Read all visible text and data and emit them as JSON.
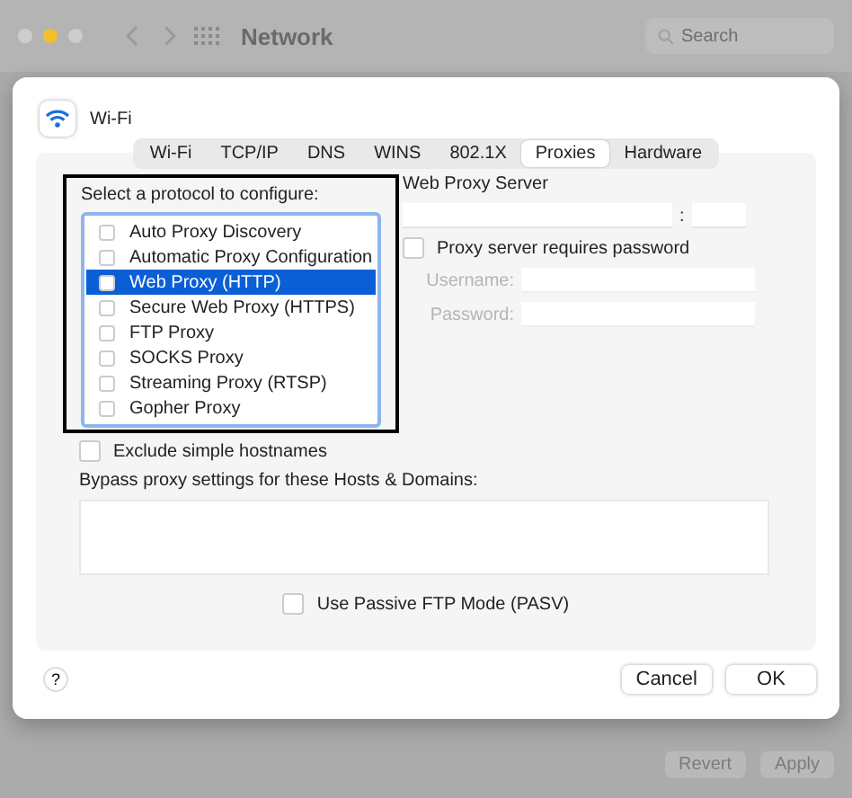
{
  "window": {
    "title": "Network",
    "search": {
      "placeholder": "Search"
    }
  },
  "sheet": {
    "service": "Wi-Fi",
    "tabs": [
      {
        "label": "Wi-Fi",
        "selected": false
      },
      {
        "label": "TCP/IP",
        "selected": false
      },
      {
        "label": "DNS",
        "selected": false
      },
      {
        "label": "WINS",
        "selected": false
      },
      {
        "label": "802.1X",
        "selected": false
      },
      {
        "label": "Proxies",
        "selected": true
      },
      {
        "label": "Hardware",
        "selected": false
      }
    ],
    "protocol_label": "Select a protocol to configure:",
    "protocols": [
      {
        "label": "Auto Proxy Discovery",
        "checked": false,
        "selected": false
      },
      {
        "label": "Automatic Proxy Configuration",
        "checked": false,
        "selected": false
      },
      {
        "label": "Web Proxy (HTTP)",
        "checked": false,
        "selected": true
      },
      {
        "label": "Secure Web Proxy (HTTPS)",
        "checked": false,
        "selected": false
      },
      {
        "label": "FTP Proxy",
        "checked": false,
        "selected": false
      },
      {
        "label": "SOCKS Proxy",
        "checked": false,
        "selected": false
      },
      {
        "label": "Streaming Proxy (RTSP)",
        "checked": false,
        "selected": false
      },
      {
        "label": "Gopher Proxy",
        "checked": false,
        "selected": false
      }
    ],
    "server_label": "Web Proxy Server",
    "server_separator": ":",
    "requires_password": {
      "label": "Proxy server requires password",
      "checked": false
    },
    "credentials": [
      {
        "label": "Username:",
        "disabled": true
      },
      {
        "label": "Password:",
        "disabled": true
      }
    ],
    "exclude_simple": {
      "label": "Exclude simple hostnames",
      "checked": false
    },
    "bypass_label": "Bypass proxy settings for these Hosts & Domains:",
    "passive_ftp": {
      "label": "Use Passive FTP Mode (PASV)",
      "checked": false
    },
    "help": "?",
    "buttons": [
      "Cancel",
      "OK"
    ]
  },
  "footer_buttons": [
    {
      "label": "Revert",
      "disabled": true
    },
    {
      "label": "Apply",
      "disabled": true
    }
  ]
}
